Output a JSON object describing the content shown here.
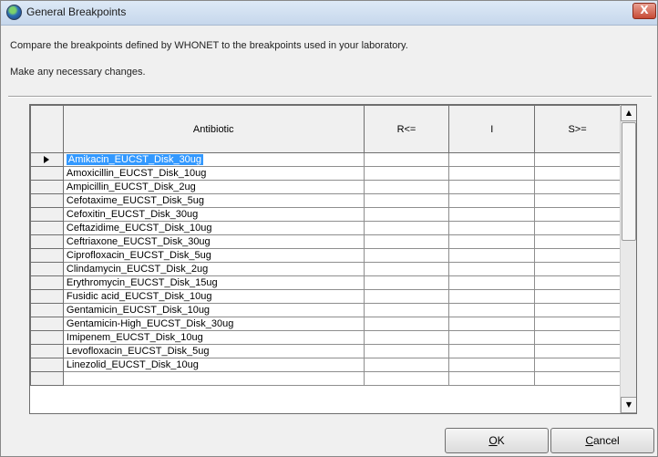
{
  "window": {
    "title": "General Breakpoints",
    "close_label": "X"
  },
  "description": {
    "line1": "Compare the breakpoints defined by WHONET to the breakpoints used in your laboratory.",
    "line2": "Make any necessary changes."
  },
  "grid": {
    "columns": [
      "Antibiotic",
      "R<=",
      "I",
      "S>="
    ],
    "rows": [
      {
        "antibiotic": "Amikacin_EUCST_Disk_30ug",
        "r": "",
        "i": "",
        "s": ""
      },
      {
        "antibiotic": "Amoxicillin_EUCST_Disk_10ug",
        "r": "",
        "i": "",
        "s": ""
      },
      {
        "antibiotic": "Ampicillin_EUCST_Disk_2ug",
        "r": "",
        "i": "",
        "s": ""
      },
      {
        "antibiotic": "Cefotaxime_EUCST_Disk_5ug",
        "r": "",
        "i": "",
        "s": ""
      },
      {
        "antibiotic": "Cefoxitin_EUCST_Disk_30ug",
        "r": "",
        "i": "",
        "s": ""
      },
      {
        "antibiotic": "Ceftazidime_EUCST_Disk_10ug",
        "r": "",
        "i": "",
        "s": ""
      },
      {
        "antibiotic": "Ceftriaxone_EUCST_Disk_30ug",
        "r": "",
        "i": "",
        "s": ""
      },
      {
        "antibiotic": "Ciprofloxacin_EUCST_Disk_5ug",
        "r": "",
        "i": "",
        "s": ""
      },
      {
        "antibiotic": "Clindamycin_EUCST_Disk_2ug",
        "r": "",
        "i": "",
        "s": ""
      },
      {
        "antibiotic": "Erythromycin_EUCST_Disk_15ug",
        "r": "",
        "i": "",
        "s": ""
      },
      {
        "antibiotic": "Fusidic acid_EUCST_Disk_10ug",
        "r": "",
        "i": "",
        "s": ""
      },
      {
        "antibiotic": "Gentamicin_EUCST_Disk_10ug",
        "r": "",
        "i": "",
        "s": ""
      },
      {
        "antibiotic": "Gentamicin-High_EUCST_Disk_30ug",
        "r": "",
        "i": "",
        "s": ""
      },
      {
        "antibiotic": "Imipenem_EUCST_Disk_10ug",
        "r": "",
        "i": "",
        "s": ""
      },
      {
        "antibiotic": "Levofloxacin_EUCST_Disk_5ug",
        "r": "",
        "i": "",
        "s": ""
      },
      {
        "antibiotic": "Linezolid_EUCST_Disk_10ug",
        "r": "",
        "i": "",
        "s": ""
      },
      {
        "antibiotic": "",
        "r": "",
        "i": "",
        "s": ""
      }
    ],
    "selected_row": 0
  },
  "buttons": {
    "ok_label": "OK",
    "cancel_label": "Cancel"
  }
}
